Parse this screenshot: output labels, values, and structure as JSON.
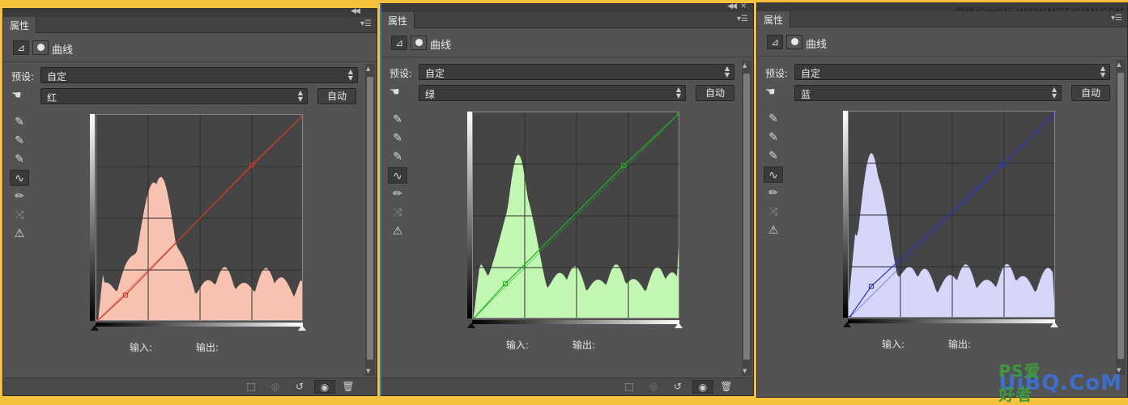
{
  "panels": [
    {
      "tab": "属性",
      "title": "曲线",
      "preset_label": "预设:",
      "preset_value": "自定",
      "channel_value": "红",
      "auto_label": "自动",
      "input_label": "输入:",
      "output_label": "输出:",
      "color": "#cc3a2a",
      "fill": "#f7c3b0",
      "control_points": [
        [
          0,
          0
        ],
        [
          36,
          33
        ],
        [
          192,
          194
        ],
        [
          255,
          255
        ]
      ]
    },
    {
      "tab": "属性",
      "title": "曲线",
      "preset_label": "预设:",
      "preset_value": "自定",
      "channel_value": "绿",
      "auto_label": "自动",
      "input_label": "输入:",
      "output_label": "输出:",
      "color": "#1fb21f",
      "fill": "#c2f7b2",
      "control_points": [
        [
          0,
          0
        ],
        [
          40,
          44
        ],
        [
          186,
          190
        ],
        [
          255,
          255
        ]
      ]
    },
    {
      "tab": "属性",
      "title": "曲线",
      "preset_label": "预设:",
      "preset_value": "自定",
      "channel_value": "蓝",
      "auto_label": "自动",
      "input_label": "输入:",
      "output_label": "输出:",
      "color": "#2a35c8",
      "fill": "#d6d6fb",
      "control_points": [
        [
          0,
          0
        ],
        [
          28,
          40
        ],
        [
          190,
          190
        ],
        [
          255,
          255
        ]
      ]
    }
  ],
  "watermark_top": "思缘设计论坛 WWW.MISSYUAN.COM",
  "watermark_bottom": "UiBQ.CoM",
  "watermark_ps": "PS爱好者"
}
